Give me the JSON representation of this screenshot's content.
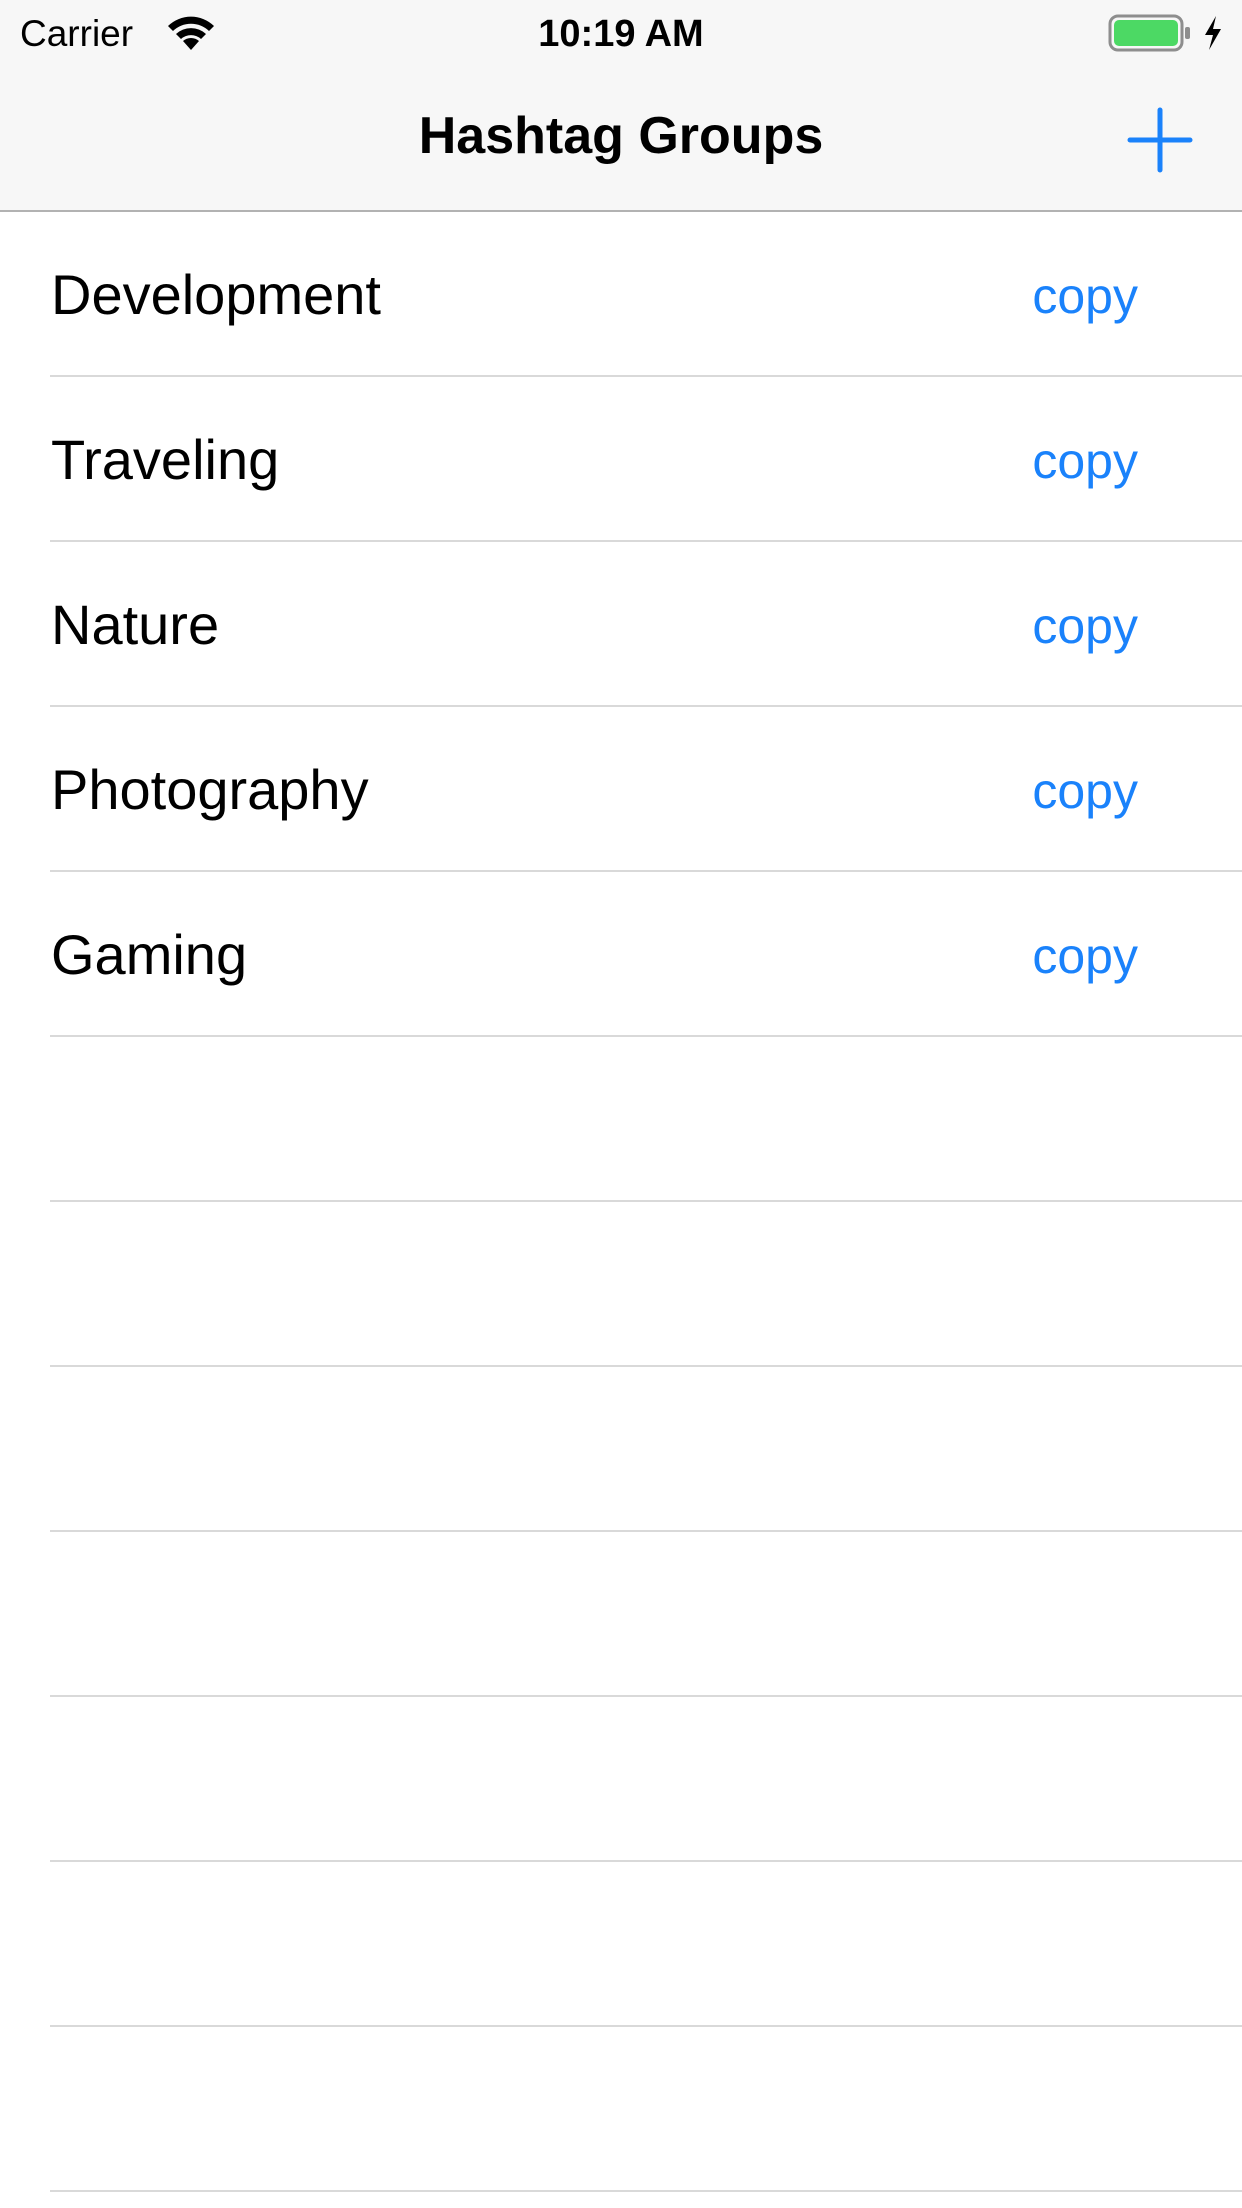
{
  "status_bar": {
    "carrier": "Carrier",
    "time": "10:19 AM",
    "wifi_icon": "wifi-icon",
    "battery_icon": "battery-icon",
    "charging_icon": "bolt-icon"
  },
  "nav_bar": {
    "title": "Hashtag Groups",
    "add_icon": "plus-icon"
  },
  "colors": {
    "accent": "#1a82fb",
    "bar_background": "#f7f7f7",
    "separator": "#d9d9d9",
    "battery_fill": "#4cd964"
  },
  "groups": [
    {
      "name": "Development",
      "action": "copy"
    },
    {
      "name": "Traveling",
      "action": "copy"
    },
    {
      "name": "Nature",
      "action": "copy"
    },
    {
      "name": "Photography",
      "action": "copy"
    },
    {
      "name": "Gaming",
      "action": "copy"
    }
  ]
}
